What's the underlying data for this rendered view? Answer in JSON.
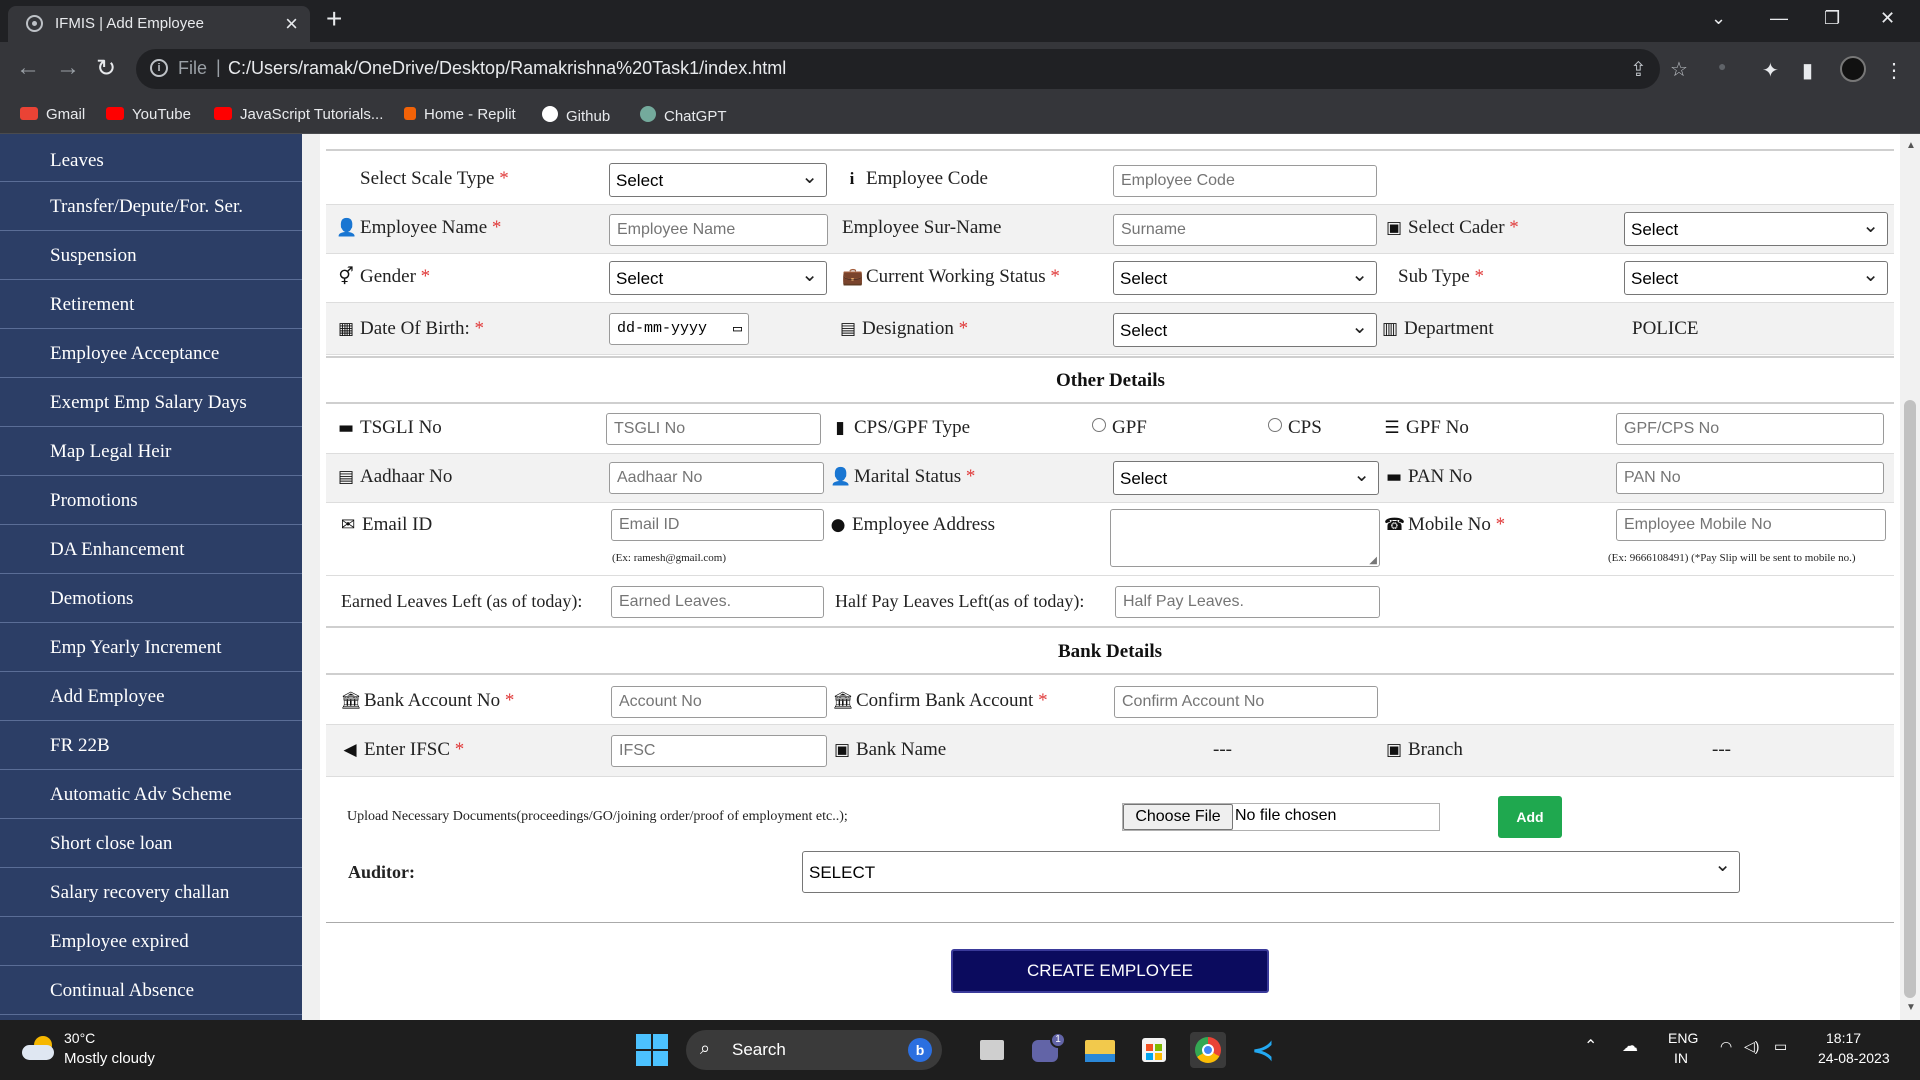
{
  "browser": {
    "tab_title": "IFMIS | Add Employee",
    "tab_close": "×",
    "new_tab": "+",
    "scheme": "File",
    "url": "C:/Users/ramak/OneDrive/Desktop/Ramakrishna%20Task1/index.html",
    "bookmarks": [
      {
        "label": "Gmail",
        "color": "#ea4335"
      },
      {
        "label": "YouTube",
        "color": "#ff0000"
      },
      {
        "label": "JavaScript Tutorials...",
        "color": "#ff0000"
      },
      {
        "label": "Home - Replit",
        "color": "#f26207"
      },
      {
        "label": "Github",
        "color": "#ffffff"
      },
      {
        "label": "ChatGPT",
        "color": "#74aa9c"
      }
    ]
  },
  "sidebar": {
    "items": [
      "Leaves",
      "Transfer/Depute/For. Ser.",
      "Suspension",
      "Retirement",
      "Employee Acceptance",
      "Exempt Emp Salary Days",
      "Map Legal Heir",
      "Promotions",
      "DA Enhancement",
      "Demotions",
      "Emp Yearly Increment",
      "Add Employee",
      "FR 22B",
      "Automatic Adv Scheme",
      "Short close loan",
      "Salary recovery challan",
      "Employee expired",
      "Continual Absence"
    ]
  },
  "form": {
    "scale_type_label": "Select Scale Type",
    "scale_type_value": "Select",
    "employee_code_label": "Employee Code",
    "employee_code_placeholder": "Employee Code",
    "employee_name_label": "Employee Name",
    "employee_name_placeholder": "Employee Name",
    "surname_label": "Employee Sur-Name",
    "surname_placeholder": "Surname",
    "cader_label": "Select Cader",
    "cader_value": "Select",
    "gender_label": "Gender",
    "gender_value": "Select",
    "working_status_label": "Current Working Status",
    "working_status_value": "Select",
    "sub_type_label": "Sub Type",
    "sub_type_value": "Select",
    "dob_label": "Date Of Birth:",
    "dob_value": "dd-mm-yyyy",
    "designation_label": "Designation",
    "designation_value": "Select",
    "department_label": "Department",
    "department_value": "POLICE",
    "required_mark": "*"
  },
  "other_details": {
    "heading": "Other Details",
    "tsgli_label": "TSGLI No",
    "tsgli_placeholder": "TSGLI No",
    "cps_gpf_type_label": "CPS/GPF Type",
    "radio_gpf": "GPF",
    "radio_cps": "CPS",
    "gpf_no_label": "GPF No",
    "gpf_no_placeholder": "GPF/CPS No",
    "aadhaar_label": "Aadhaar No",
    "aadhaar_placeholder": "Aadhaar No",
    "marital_label": "Marital Status",
    "marital_value": "Select",
    "pan_label": "PAN No",
    "pan_placeholder": "PAN No",
    "email_label": "Email ID",
    "email_placeholder": "Email ID",
    "email_hint": "(Ex: ramesh@gmail.com)",
    "address_label": "Employee Address",
    "mobile_label": "Mobile No",
    "mobile_placeholder": "Employee Mobile No",
    "mobile_hint": "(Ex: 9666108491) (*Pay Slip will be sent to mobile no.)",
    "earned_leaves_label": "Earned Leaves Left (as of today):",
    "earned_leaves_placeholder": "Earned Leaves.",
    "half_pay_label": "Half Pay Leaves Left(as of today):",
    "half_pay_placeholder": "Half Pay Leaves."
  },
  "bank_details": {
    "heading": "Bank Details",
    "account_label": "Bank Account No",
    "account_placeholder": "Account No",
    "confirm_label": "Confirm Bank Account",
    "confirm_placeholder": "Confirm Account No",
    "ifsc_label": "Enter IFSC",
    "ifsc_placeholder": "IFSC",
    "bank_name_label": "Bank Name",
    "bank_name_value": "---",
    "branch_label": "Branch",
    "branch_value": "---"
  },
  "upload": {
    "label": "Upload Necessary Documents(proceedings/GO/joining order/proof of employment etc..);",
    "choose_file": "Choose File",
    "no_file": "No file chosen",
    "add_button": "Add",
    "auditor_label": "Auditor:",
    "auditor_value": "SELECT",
    "create_button": "CREATE EMPLOYEE"
  },
  "taskbar": {
    "temperature": "30°C",
    "condition": "Mostly cloudy",
    "search": "Search",
    "notification_badge": "1",
    "lang_top": "ENG",
    "lang_bottom": "IN",
    "time": "18:17",
    "date": "24-08-2023"
  }
}
